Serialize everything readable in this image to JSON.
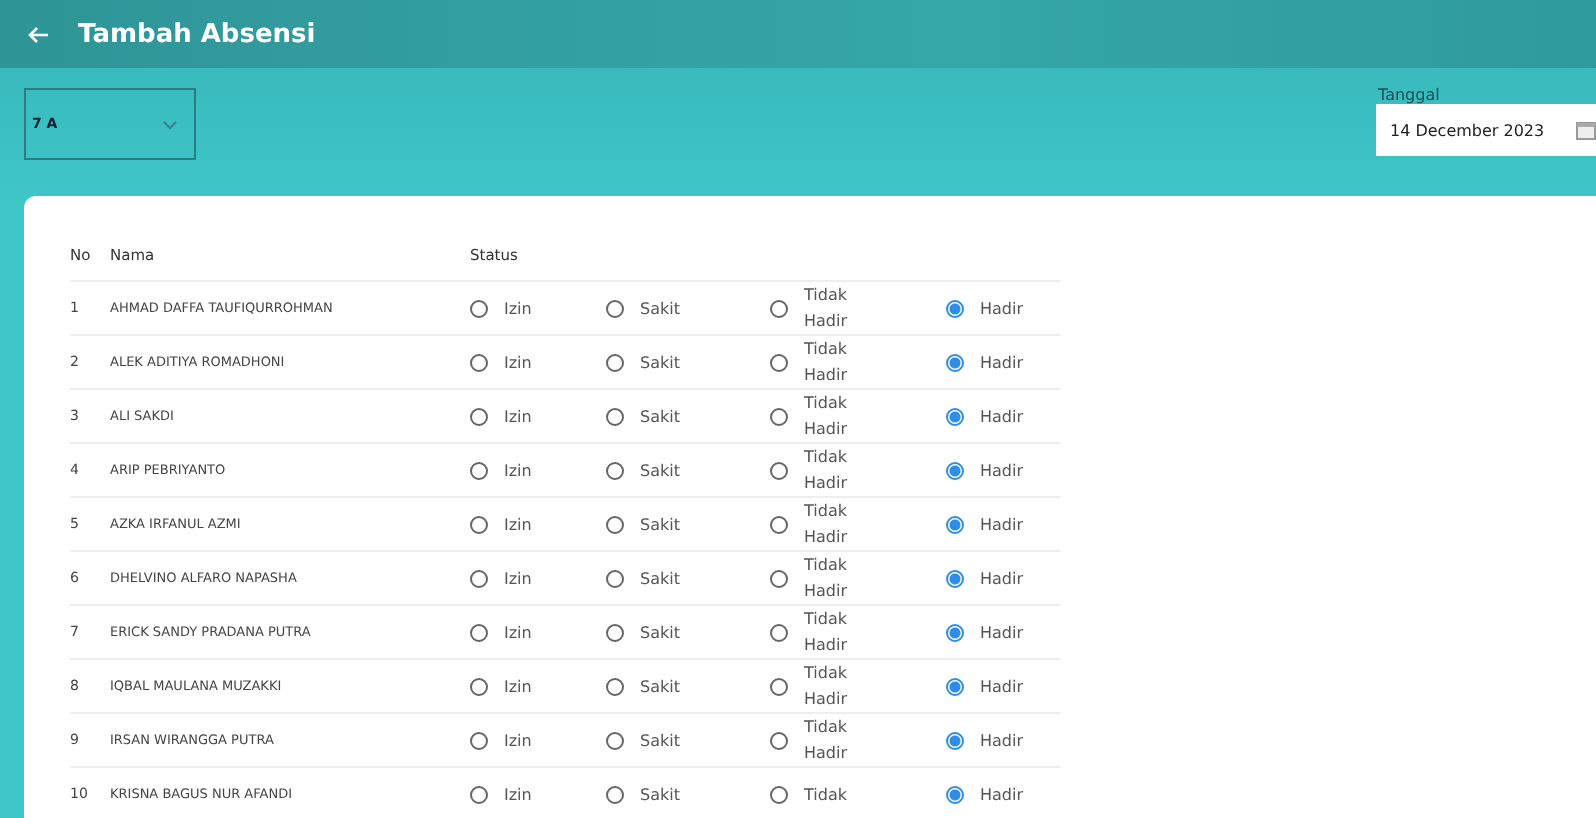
{
  "app_bar": {
    "title": "Tambah Absensi"
  },
  "class_select": {
    "value": "7 A"
  },
  "date_field": {
    "label": "Tanggal",
    "value": "14 December 2023"
  },
  "table": {
    "columns": [
      "No",
      "Nama",
      "Status"
    ],
    "rows": [
      {
        "no": "1",
        "name": "AHMAD DAFFA TAUFIQURROHMAN",
        "options": [
          {
            "label": "Izin",
            "selected": false
          },
          {
            "label": "Sakit",
            "selected": false
          },
          {
            "label": "Tidak Hadir",
            "selected": false
          },
          {
            "label": "Hadir",
            "selected": true
          }
        ]
      },
      {
        "no": "2",
        "name": "ALEK ADITIYA ROMADHONI",
        "options": [
          {
            "label": "Izin",
            "selected": false
          },
          {
            "label": "Sakit",
            "selected": false
          },
          {
            "label": "Tidak Hadir",
            "selected": false
          },
          {
            "label": "Hadir",
            "selected": true
          }
        ]
      },
      {
        "no": "3",
        "name": "ALI SAKDI",
        "options": [
          {
            "label": "Izin",
            "selected": false
          },
          {
            "label": "Sakit",
            "selected": false
          },
          {
            "label": "Tidak Hadir",
            "selected": false
          },
          {
            "label": "Hadir",
            "selected": true
          }
        ]
      },
      {
        "no": "4",
        "name": "ARIP PEBRIYANTO",
        "options": [
          {
            "label": "Izin",
            "selected": false
          },
          {
            "label": "Sakit",
            "selected": false
          },
          {
            "label": "Tidak Hadir",
            "selected": false
          },
          {
            "label": "Hadir",
            "selected": true
          }
        ]
      },
      {
        "no": "5",
        "name": "AZKA IRFANUL AZMI",
        "options": [
          {
            "label": "Izin",
            "selected": false
          },
          {
            "label": "Sakit",
            "selected": false
          },
          {
            "label": "Tidak Hadir",
            "selected": false
          },
          {
            "label": "Hadir",
            "selected": true
          }
        ]
      },
      {
        "no": "6",
        "name": "DHELVINO ALFARO NAPASHA",
        "options": [
          {
            "label": "Izin",
            "selected": false
          },
          {
            "label": "Sakit",
            "selected": false
          },
          {
            "label": "Tidak Hadir",
            "selected": false
          },
          {
            "label": "Hadir",
            "selected": true
          }
        ]
      },
      {
        "no": "7",
        "name": "ERICK SANDY PRADANA PUTRA",
        "options": [
          {
            "label": "Izin",
            "selected": false
          },
          {
            "label": "Sakit",
            "selected": false
          },
          {
            "label": "Tidak Hadir",
            "selected": false
          },
          {
            "label": "Hadir",
            "selected": true
          }
        ]
      },
      {
        "no": "8",
        "name": "IQBAL MAULANA MUZAKKI",
        "options": [
          {
            "label": "Izin",
            "selected": false
          },
          {
            "label": "Sakit",
            "selected": false
          },
          {
            "label": "Tidak Hadir",
            "selected": false
          },
          {
            "label": "Hadir",
            "selected": true
          }
        ]
      },
      {
        "no": "9",
        "name": "IRSAN WIRANGGA PUTRA",
        "options": [
          {
            "label": "Izin",
            "selected": false
          },
          {
            "label": "Sakit",
            "selected": false
          },
          {
            "label": "Tidak Hadir",
            "selected": false
          },
          {
            "label": "Hadir",
            "selected": true
          }
        ]
      },
      {
        "no": "10",
        "name": "KRISNA BAGUS NUR AFANDI",
        "options": [
          {
            "label": "Izin",
            "selected": false
          },
          {
            "label": "Sakit",
            "selected": false
          },
          {
            "label": "Tidak",
            "selected": false
          },
          {
            "label": "Hadir",
            "selected": true
          }
        ]
      }
    ]
  }
}
